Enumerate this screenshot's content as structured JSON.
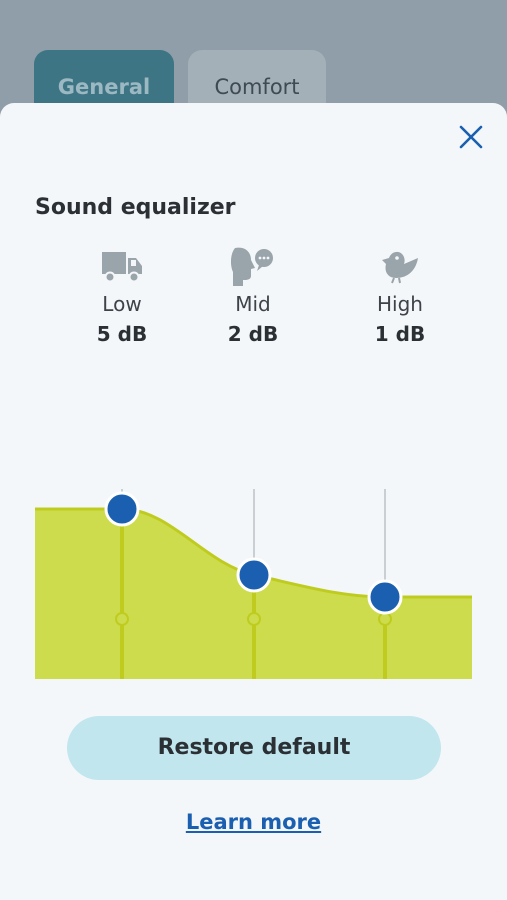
{
  "tabs": [
    {
      "label": "General",
      "active": true
    },
    {
      "label": "Comfort",
      "active": false
    }
  ],
  "panel": {
    "title": "Sound equalizer",
    "close_icon": "close-icon"
  },
  "bands": [
    {
      "label": "Low",
      "value": "5 dB",
      "icon": "truck-icon",
      "db": 5
    },
    {
      "label": "Mid",
      "value": "2 dB",
      "icon": "speaking-head-icon",
      "db": 2
    },
    {
      "label": "High",
      "value": "1 dB",
      "icon": "bird-icon",
      "db": 1
    }
  ],
  "colors": {
    "fill": "#cddc4c",
    "stroke": "#bfcc1f",
    "knob": "#1a5fb0",
    "accent": "#1a5fb0",
    "tab_active": "#3e7585"
  },
  "actions": {
    "restore_label": "Restore default",
    "learn_more_label": "Learn more"
  }
}
